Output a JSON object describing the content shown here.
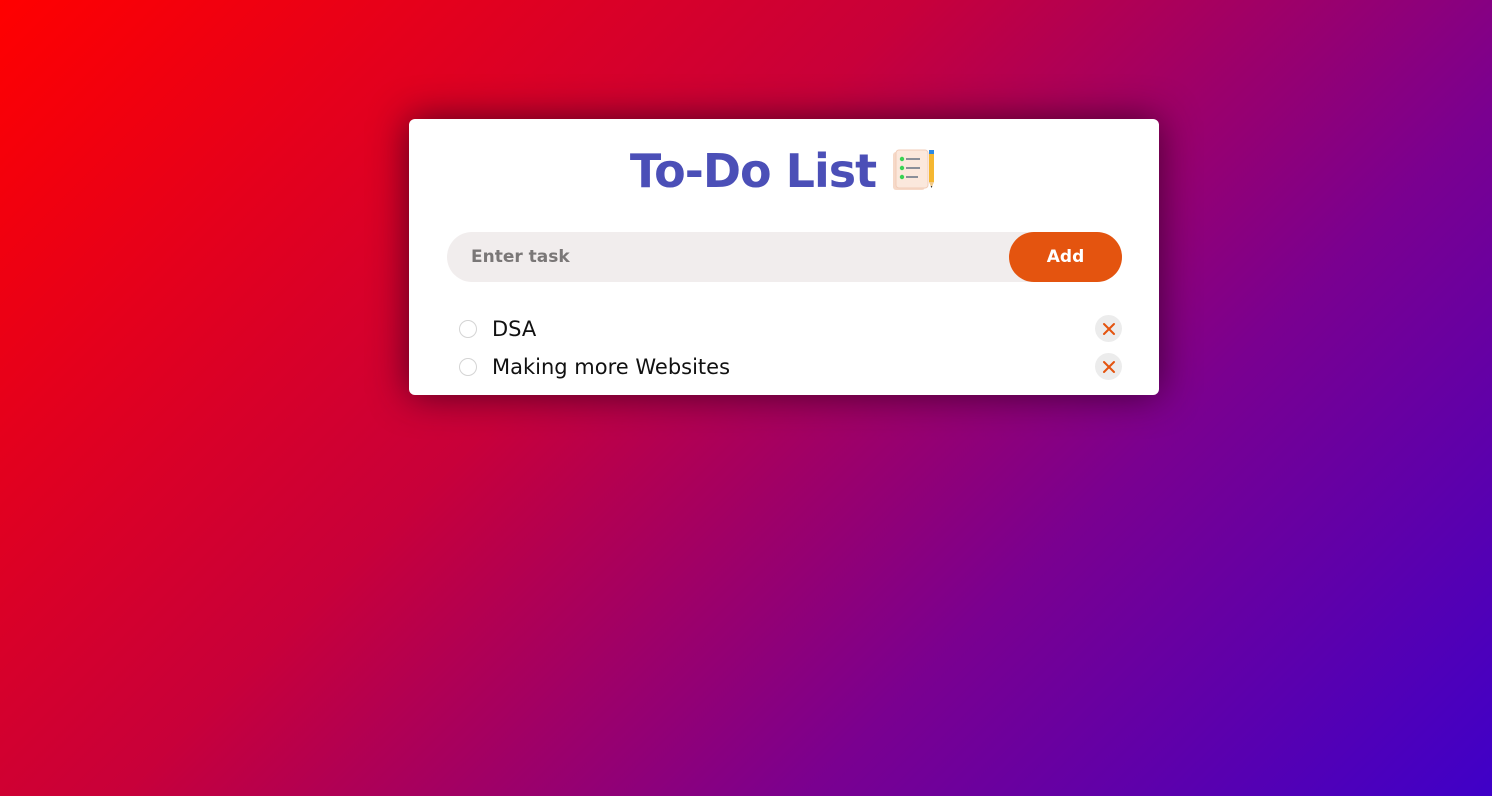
{
  "app": {
    "title": "To-Do List",
    "title_icon": "notepad-checklist-icon"
  },
  "input": {
    "placeholder": "Enter task",
    "value": ""
  },
  "add_button": {
    "label": "Add"
  },
  "tasks": [
    {
      "text": "DSA",
      "completed": false
    },
    {
      "text": "Making more Websites",
      "completed": false
    }
  ],
  "colors": {
    "title": "#4b4fb7",
    "accent": "#e4540f",
    "input_bg": "#f1eded",
    "gradient_start": "#ff0000",
    "gradient_end": "#3f00c8"
  }
}
